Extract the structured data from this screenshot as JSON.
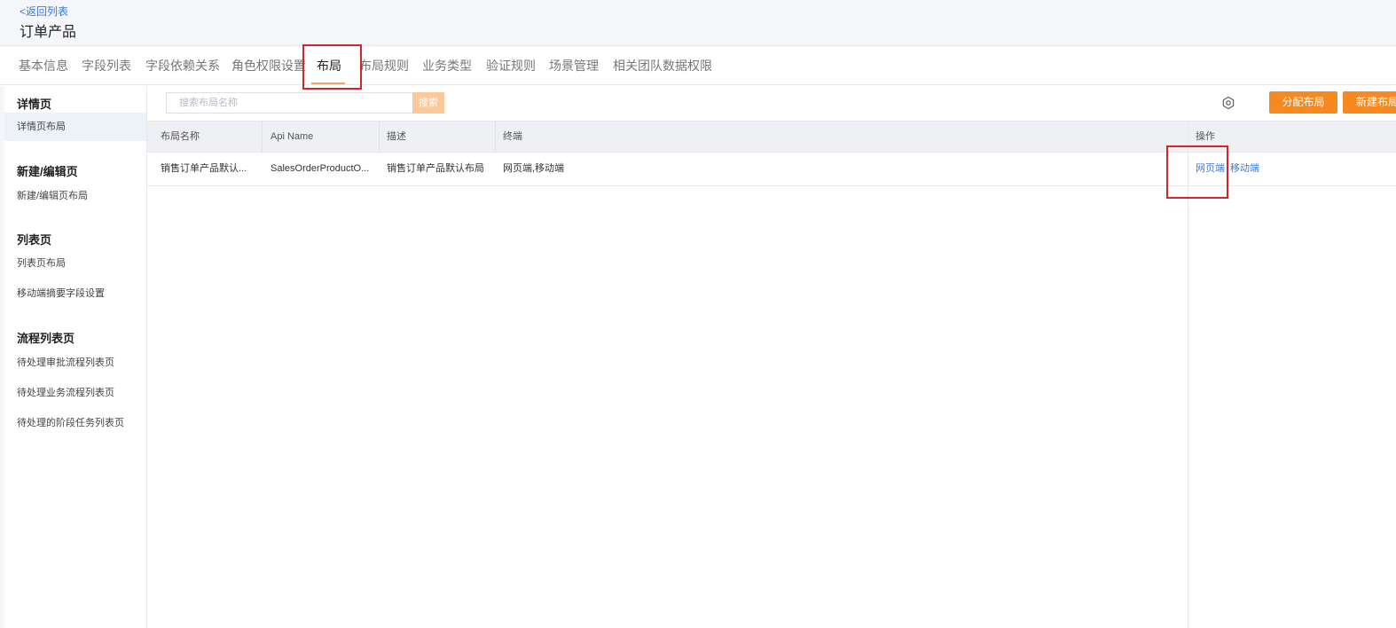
{
  "header": {
    "back_link": "<返回列表",
    "title": "订单产品"
  },
  "tabs": [
    {
      "label": "基本信息"
    },
    {
      "label": "字段列表"
    },
    {
      "label": "字段依赖关系"
    },
    {
      "label": "角色权限设置"
    },
    {
      "label": "布局",
      "active": true
    },
    {
      "label": "布局规则"
    },
    {
      "label": "业务类型"
    },
    {
      "label": "验证规则"
    },
    {
      "label": "场景管理"
    },
    {
      "label": "相关团队数据权限"
    }
  ],
  "sidebar": {
    "groups": [
      {
        "heading": "详情页",
        "items": [
          "详情页布局"
        ]
      },
      {
        "heading": "新建/编辑页",
        "items": [
          "新建/编辑页布局"
        ]
      },
      {
        "heading": "列表页",
        "items": [
          "列表页布局",
          "移动端摘要字段设置"
        ]
      },
      {
        "heading": "流程列表页",
        "items": [
          "待处理审批流程列表页",
          "待处理业务流程列表页",
          "待处理的阶段任务列表页"
        ]
      }
    ]
  },
  "toolbar": {
    "search_placeholder": "搜索布局名称",
    "search_label": "搜索",
    "assign_label": "分配布局",
    "new_label": "新建布局"
  },
  "table": {
    "columns": [
      "布局名称",
      "Api Name",
      "描述",
      "终端",
      "操作"
    ],
    "rows": [
      {
        "name": "销售订单产品默认...",
        "api_name": "SalesOrderProductO...",
        "description": "销售订单产品默认布局",
        "terminal": "网页端,移动端",
        "ops": [
          "网页端",
          "移动端"
        ]
      }
    ]
  },
  "colors": {
    "accent": "#f6891f",
    "link": "#3a7bd5",
    "highlight": "#d7232e"
  }
}
